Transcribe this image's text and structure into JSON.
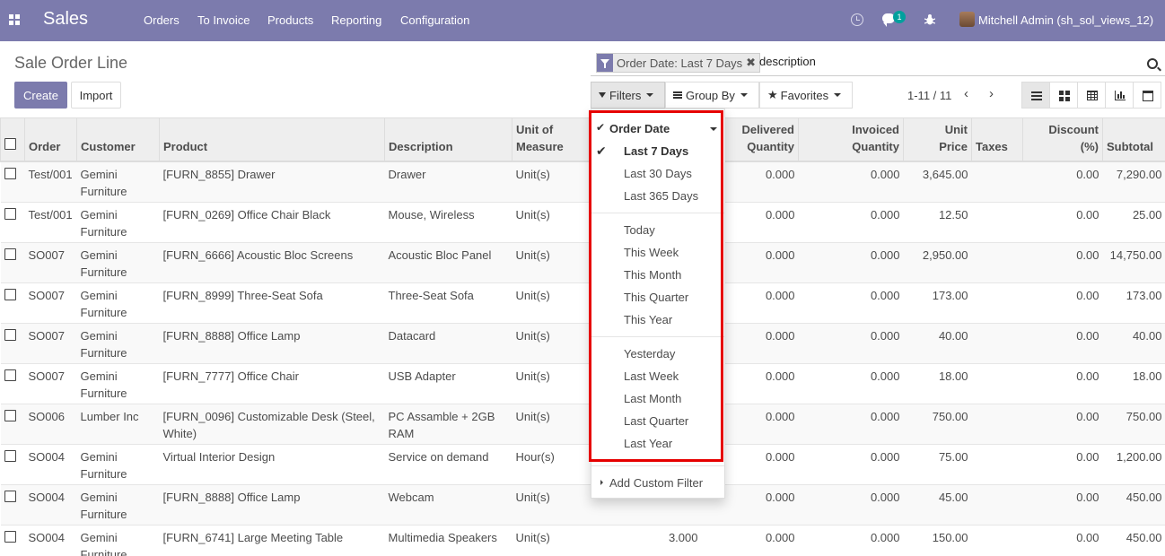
{
  "navbar": {
    "brand": "Sales",
    "menu": [
      "Orders",
      "To Invoice",
      "Products",
      "Reporting",
      "Configuration"
    ],
    "chat_badge": "1",
    "user": "Mitchell Admin (sh_sol_views_12)"
  },
  "control": {
    "title": "Sale Order Line",
    "create_label": "Create",
    "import_label": "Import",
    "facet_label": "Order Date: Last 7 Days",
    "facet_close": "✖",
    "search_value": "description",
    "filters_label": "Filters",
    "groupby_label": "Group By",
    "favorites_label": "Favorites",
    "pager": "1-11 / 11",
    "pager_prev": "‹",
    "pager_next": "›",
    "star": "★"
  },
  "table": {
    "headers": {
      "order": "Order",
      "customer": "Customer",
      "product": "Product",
      "description": "Description",
      "uom1": "Unit of",
      "uom2": "Measure",
      "delivered1": "Delivered",
      "delivered2": "Quantity",
      "invoiced1": "Invoiced",
      "invoiced2": "Quantity",
      "price1": "Unit",
      "price2": "Price",
      "taxes": "Taxes",
      "discount1": "Discount",
      "discount2": "(%)",
      "subtotal": "Subtotal"
    },
    "rows": [
      {
        "order": "Test/001",
        "customer": "Gemini Furniture",
        "product": "[FURN_8855] Drawer",
        "description": "Drawer",
        "uom": "Unit(s)",
        "qty": "",
        "delivered": "0.000",
        "invoiced": "0.000",
        "price": "3,645.00",
        "taxes": "",
        "discount": "0.00",
        "subtotal": "7,290.00"
      },
      {
        "order": "Test/001",
        "customer": "Gemini Furniture",
        "product": "[FURN_0269] Office Chair Black",
        "description": "Mouse, Wireless",
        "uom": "Unit(s)",
        "qty": "",
        "delivered": "0.000",
        "invoiced": "0.000",
        "price": "12.50",
        "taxes": "",
        "discount": "0.00",
        "subtotal": "25.00"
      },
      {
        "order": "SO007",
        "customer": "Gemini Furniture",
        "product": "[FURN_6666] Acoustic Bloc Screens",
        "description": "Acoustic Bloc Panel",
        "uom": "Unit(s)",
        "qty": "",
        "delivered": "0.000",
        "invoiced": "0.000",
        "price": "2,950.00",
        "taxes": "",
        "discount": "0.00",
        "subtotal": "14,750.00"
      },
      {
        "order": "SO007",
        "customer": "Gemini Furniture",
        "product": "[FURN_8999] Three-Seat Sofa",
        "description": "Three-Seat Sofa",
        "uom": "Unit(s)",
        "qty": "",
        "delivered": "0.000",
        "invoiced": "0.000",
        "price": "173.00",
        "taxes": "",
        "discount": "0.00",
        "subtotal": "173.00"
      },
      {
        "order": "SO007",
        "customer": "Gemini Furniture",
        "product": "[FURN_8888] Office Lamp",
        "description": "Datacard",
        "uom": "Unit(s)",
        "qty": "",
        "delivered": "0.000",
        "invoiced": "0.000",
        "price": "40.00",
        "taxes": "",
        "discount": "0.00",
        "subtotal": "40.00"
      },
      {
        "order": "SO007",
        "customer": "Gemini Furniture",
        "product": "[FURN_7777] Office Chair",
        "description": "USB Adapter",
        "uom": "Unit(s)",
        "qty": "",
        "delivered": "0.000",
        "invoiced": "0.000",
        "price": "18.00",
        "taxes": "",
        "discount": "0.00",
        "subtotal": "18.00"
      },
      {
        "order": "SO006",
        "customer": "Lumber Inc",
        "product": "[FURN_0096] Customizable Desk (Steel, White)",
        "description": "PC Assamble + 2GB RAM",
        "uom": "Unit(s)",
        "qty": "",
        "delivered": "0.000",
        "invoiced": "0.000",
        "price": "750.00",
        "taxes": "",
        "discount": "0.00",
        "subtotal": "750.00"
      },
      {
        "order": "SO004",
        "customer": "Gemini Furniture",
        "product": "Virtual Interior Design",
        "description": "Service on demand",
        "uom": "Hour(s)",
        "qty": "",
        "delivered": "0.000",
        "invoiced": "0.000",
        "price": "75.00",
        "taxes": "",
        "discount": "0.00",
        "subtotal": "1,200.00"
      },
      {
        "order": "SO004",
        "customer": "Gemini Furniture",
        "product": "[FURN_8888] Office Lamp",
        "description": "Webcam",
        "uom": "Unit(s)",
        "qty": "",
        "delivered": "0.000",
        "invoiced": "0.000",
        "price": "45.00",
        "taxes": "",
        "discount": "0.00",
        "subtotal": "450.00"
      },
      {
        "order": "SO004",
        "customer": "Gemini Furniture",
        "product": "[FURN_6741] Large Meeting Table",
        "description": "Multimedia Speakers",
        "uom": "Unit(s)",
        "qty": "3.000",
        "delivered": "0.000",
        "invoiced": "0.000",
        "price": "150.00",
        "taxes": "",
        "discount": "0.00",
        "subtotal": "450.00"
      }
    ]
  },
  "dropdown": {
    "group_label": "Order Date",
    "check": "✔",
    "options1": [
      "Last 7 Days",
      "Last 30 Days",
      "Last 365 Days"
    ],
    "options2": [
      "Today",
      "This Week",
      "This Month",
      "This Quarter",
      "This Year"
    ],
    "options3": [
      "Yesterday",
      "Last Week",
      "Last Month",
      "Last Quarter",
      "Last Year"
    ],
    "custom_label": "Add Custom Filter"
  },
  "colors": {
    "brand": "#7c7bad",
    "badge": "#00a09d",
    "highlight": "#e60000"
  }
}
